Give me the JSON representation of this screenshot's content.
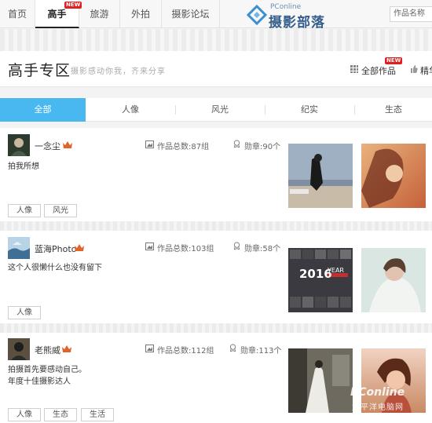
{
  "nav": {
    "tabs": [
      "首页",
      "高手",
      "旅游",
      "外拍",
      "摄影论坛"
    ],
    "active_index": 1,
    "new_badge": "NEW"
  },
  "logo": {
    "small": "PConline",
    "big": "摄影部落"
  },
  "search_select": {
    "value": "作品名称"
  },
  "header": {
    "title": "高手专区",
    "subtitle": "摄影感动你我，齐来分享",
    "all_works": "全部作品",
    "featured": "精华",
    "new_badge": "NEW"
  },
  "categories": [
    "全部",
    "人像",
    "风光",
    "纪实",
    "生态"
  ],
  "users": [
    {
      "name": "一念尘",
      "works": "作品总数:87组",
      "medals": "勋章:90个",
      "bio": [
        "拍我所想"
      ],
      "tags": [
        "人像",
        "风光"
      ]
    },
    {
      "name": "蓝海Photo",
      "works": "作品总数:103组",
      "medals": "勋章:58个",
      "bio": [
        "这个人很懒什么也没有留下"
      ],
      "tags": [
        "人像"
      ]
    },
    {
      "name": "老熊威",
      "works": "作品总数:112组",
      "medals": "勋章:113个",
      "bio": [
        "拍摄首先要感动自己。",
        "年度十佳摄影达人"
      ],
      "tags": [
        "人像",
        "生态",
        "生活"
      ]
    }
  ],
  "thumb_texts": {
    "year_big": "2016",
    "year_word": "YEAR"
  },
  "watermark": {
    "text": "PConline",
    "sub": "太平洋电脑网"
  },
  "colors": {
    "accent": "#4ab8f0",
    "crown": "#e0642a",
    "new_badge": "#e02020",
    "logo": "#355e8c"
  }
}
